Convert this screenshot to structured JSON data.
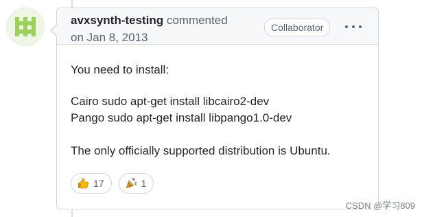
{
  "comment": {
    "author": "avxsynth-testing",
    "action": "commented",
    "date": "on Jan 8, 2013",
    "badge": "Collaborator",
    "more_icon": "kebab-horizontal-icon",
    "body": {
      "line1": "You need to install:",
      "line2a": "Cairo sudo apt-get install libcairo2-dev",
      "line2b": "Pango sudo apt-get install libpango1.0-dev",
      "line3": "The only officially supported distribution is Ubuntu."
    },
    "reactions": [
      {
        "icon": "thumbs-up-icon",
        "count": "17"
      },
      {
        "icon": "tada-icon",
        "count": "1"
      }
    ]
  },
  "watermark": "CSDN @学习809",
  "colors": {
    "border": "#d0d7de",
    "header_bg": "#f6f8fa",
    "text": "#1f2328",
    "muted": "#59636e",
    "avatar_green": "#9ccf5c"
  }
}
